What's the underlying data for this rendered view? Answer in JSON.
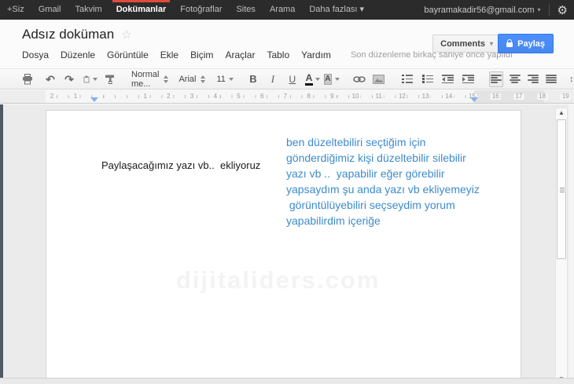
{
  "topbar": {
    "items": [
      "+Siz",
      "Gmail",
      "Takvim",
      "Dokümanlar",
      "Fotoğraflar",
      "Sites",
      "Arama",
      "Daha fazlası ▾"
    ],
    "active_index": 3,
    "account": "bayramakadir56@gmail.com"
  },
  "header": {
    "title": "Adsız doküman",
    "menus": [
      "Dosya",
      "Düzenle",
      "Görüntüle",
      "Ekle",
      "Biçim",
      "Araçlar",
      "Tablo",
      "Yardım"
    ],
    "status": "Son düzenleme birkaç saniye önce yapıldı",
    "comments_label": "Comments",
    "share_label": "Paylaş"
  },
  "toolbar": {
    "style_value": "Normal me...",
    "font_value": "Arial",
    "size_value": "11",
    "bold_label": "B",
    "italic_label": "I",
    "underline_label": "U",
    "text_color_label": "A",
    "highlight_label": "A"
  },
  "ruler": {
    "left_numbers": [
      "2",
      "1"
    ],
    "main_numbers": [
      "1",
      "2",
      "3",
      "4",
      "5",
      "6",
      "7",
      "8",
      "9",
      "10",
      "11",
      "12",
      "13",
      "14",
      "15",
      "16",
      "17",
      "18",
      "19"
    ]
  },
  "document": {
    "paragraph": "Paylaşacağımız yazı vb..  ekliyoruz",
    "blue_lines": [
      "ben düzeltebiliri seçtiğim için",
      "gönderdiğimiz kişi düzeltebilir silebilir",
      "yazı vb ..  yapabilir eğer görebilir",
      "yapsaydım şu anda yazı vb ekliyemeyiz",
      " görüntülüyebiliri seçseydim yorum",
      "yapabilirdim içeriğe"
    ],
    "blue_color": "#3d8bcd",
    "watermark": "dijitaliders.com"
  },
  "icons": {
    "gear": "⚙",
    "star": "☆",
    "caret": "▾",
    "undo": "↶",
    "redo": "↷",
    "line_spacing_arrow": "↕",
    "scroll_up": "▲",
    "scroll_down": "▼"
  },
  "colors": {
    "accent_blue": "#4d90fe",
    "topbar_red": "#dd4b39",
    "blue_text": "#3d8bcd"
  }
}
